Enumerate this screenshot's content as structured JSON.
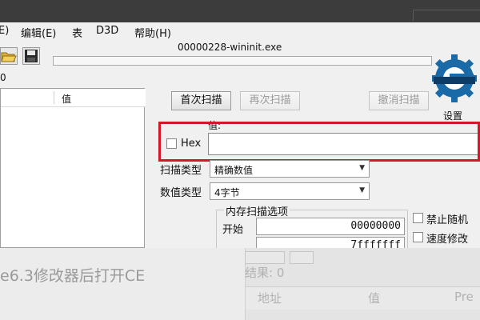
{
  "menu": {
    "file_fragment": "E)",
    "edit": "编辑(E)",
    "table": "表",
    "d3d": "D3D",
    "help": "帮助(H)"
  },
  "process_title": "00000228-wininit.exe",
  "found_count": "0",
  "settings_label": "设置",
  "icons": {
    "open": "folder-open-icon",
    "save": "floppy-disk-icon",
    "logo": "cheat-engine-logo"
  },
  "address_list": {
    "value_header": "值"
  },
  "scan_buttons": {
    "first": "首次扫描",
    "next": "再次扫描",
    "undo": "撤消扫描"
  },
  "value_section": {
    "label": "值:",
    "hex_label": "Hex",
    "value": ""
  },
  "scan_type": {
    "label": "扫描类型",
    "selected": "精确数值"
  },
  "value_type": {
    "label": "数值类型",
    "selected": "4字节"
  },
  "memory_options": {
    "title": "内存扫描选项",
    "start_label": "开始",
    "start_value": "00000000",
    "stop_value": "7fffffff"
  },
  "right_options": {
    "disable_random": "禁止随机",
    "speed_modify": "速度修改"
  },
  "caption_fragment": "e6.3修改器后打开CE",
  "ghost": {
    "results": "结果: 0",
    "address": "地址",
    "value": "值",
    "pre": "Pre"
  },
  "colors": {
    "highlight_red": "#d3162a",
    "window_bg": "#f0f0f0",
    "backdrop": "#3a3a3a"
  }
}
